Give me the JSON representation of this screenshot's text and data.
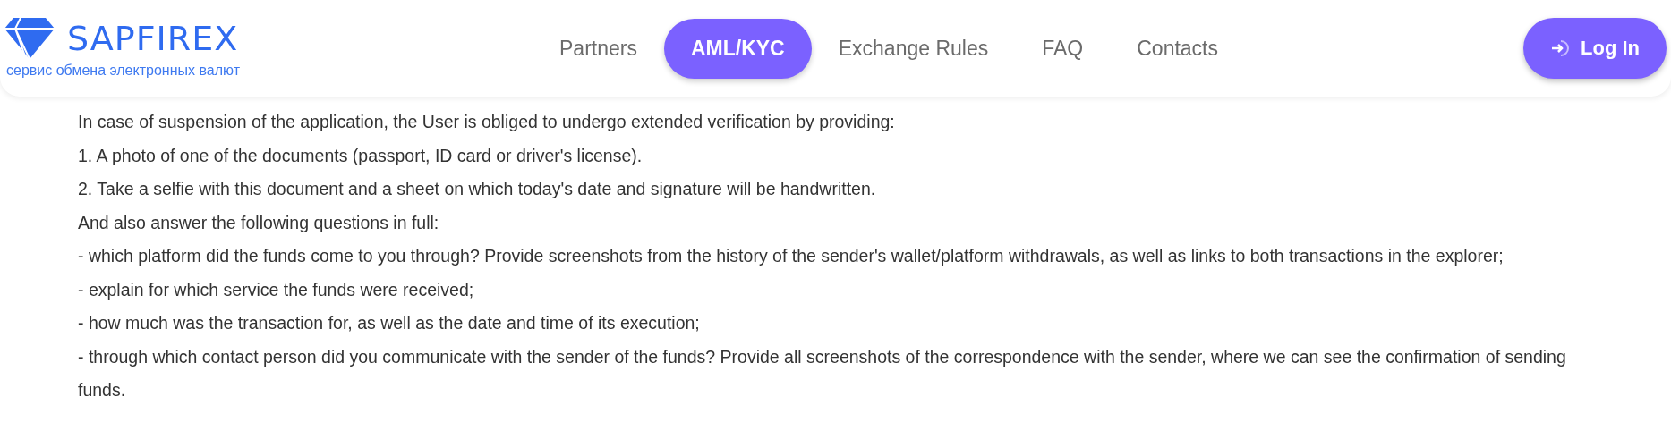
{
  "header": {
    "logo": {
      "name": "SAPFIREX",
      "tagline": "сервис обмена электронных валют"
    },
    "nav": [
      {
        "label": "Partners",
        "selected": false
      },
      {
        "label": "AML/KYC",
        "selected": true
      },
      {
        "label": "Exchange Rules",
        "selected": false
      },
      {
        "label": "FAQ",
        "selected": false
      },
      {
        "label": "Contacts",
        "selected": false
      }
    ],
    "login": {
      "label": "Log In"
    }
  },
  "content": {
    "paragraphs": [
      "In case of suspension of the application, the User is obliged to undergo extended verification by providing:",
      "1. A photo of one of the documents (passport, ID card or driver's license).",
      "2. Take a selfie with this document and a sheet on which today's date and signature will be handwritten.",
      "And also answer the following questions in full:",
      "- which platform did the funds come to you through? Provide screenshots from the history of the sender's wallet/platform withdrawals, as well as links to both transactions in the explorer;",
      "- explain for which service the funds were received;",
      "- how much was the transaction for, as well as the date and time of its execution;",
      "- through which contact person did you communicate with the sender of the funds? Provide all screenshots of the correspondence with the sender, where we can see the confirmation of sending funds."
    ]
  }
}
